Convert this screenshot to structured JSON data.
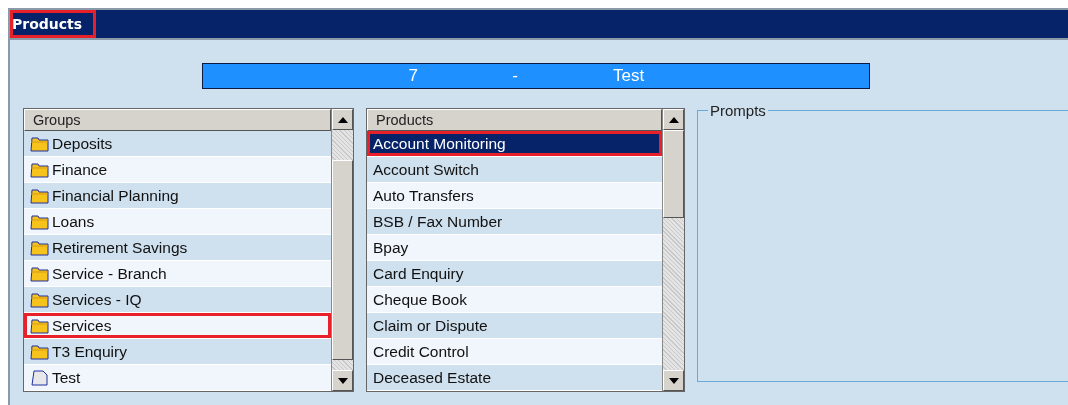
{
  "window": {
    "title": "Products",
    "title_highlighted": true
  },
  "banner": {
    "code": "7",
    "separator": "-",
    "name": "Test"
  },
  "groups": {
    "header": "Groups",
    "items": [
      {
        "label": "Deposits",
        "kind": "folder",
        "highlighted": false
      },
      {
        "label": "Finance",
        "kind": "folder",
        "highlighted": false
      },
      {
        "label": "Financial Planning",
        "kind": "folder",
        "highlighted": false
      },
      {
        "label": "Loans",
        "kind": "folder",
        "highlighted": false
      },
      {
        "label": "Retirement Savings",
        "kind": "folder",
        "highlighted": false
      },
      {
        "label": "Service - Branch",
        "kind": "folder",
        "highlighted": false
      },
      {
        "label": "Services - IQ",
        "kind": "folder",
        "highlighted": false
      },
      {
        "label": "Services",
        "kind": "folder",
        "highlighted": true
      },
      {
        "label": "T3 Enquiry",
        "kind": "folder",
        "highlighted": false
      },
      {
        "label": "Test",
        "kind": "document",
        "highlighted": false
      }
    ]
  },
  "products": {
    "header": "Products",
    "items": [
      {
        "label": "Account Monitoring",
        "selected": true,
        "highlighted": true
      },
      {
        "label": "Account Switch",
        "selected": false,
        "highlighted": false
      },
      {
        "label": "Auto Transfers",
        "selected": false,
        "highlighted": false
      },
      {
        "label": "BSB / Fax Number",
        "selected": false,
        "highlighted": false
      },
      {
        "label": "Bpay",
        "selected": false,
        "highlighted": false
      },
      {
        "label": "Card Enquiry",
        "selected": false,
        "highlighted": false
      },
      {
        "label": "Cheque Book",
        "selected": false,
        "highlighted": false
      },
      {
        "label": "Claim or Dispute",
        "selected": false,
        "highlighted": false
      },
      {
        "label": "Credit Control",
        "selected": false,
        "highlighted": false
      },
      {
        "label": "Deceased Estate",
        "selected": false,
        "highlighted": false
      }
    ]
  },
  "prompts": {
    "legend": "Prompts"
  }
}
